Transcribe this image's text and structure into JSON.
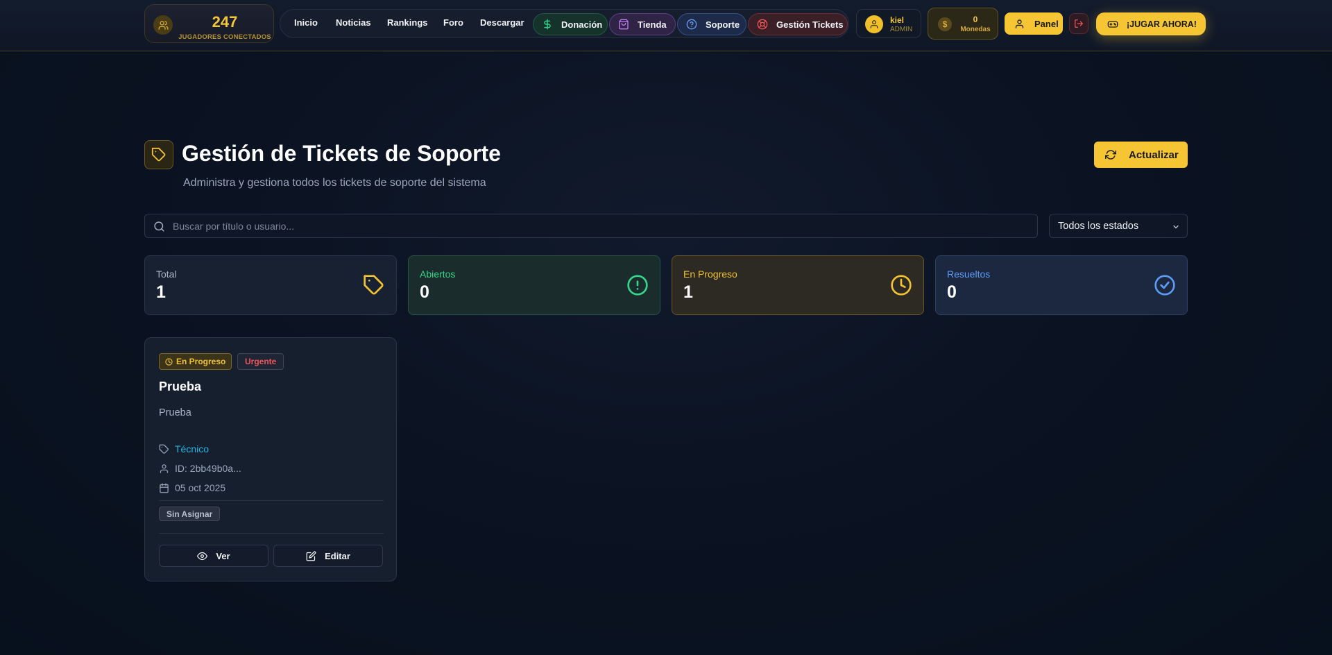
{
  "topbar": {
    "players": {
      "count": "247",
      "label": "JUGADORES CONECTADOS",
      "icon": "users-icon"
    },
    "nav": [
      {
        "label": "Inicio"
      },
      {
        "label": "Noticias"
      },
      {
        "label": "Rankings"
      },
      {
        "label": "Foro"
      },
      {
        "label": "Descargar"
      }
    ],
    "pills": {
      "donation": {
        "label": "Donación",
        "icon": "dollar-icon",
        "color": "#22c57e"
      },
      "store": {
        "label": "Tienda",
        "icon": "shopping-bag-icon",
        "color": "#b06ae0"
      },
      "support": {
        "label": "Soporte",
        "icon": "help-circle-icon",
        "color": "#5c8ff0"
      },
      "tickets": {
        "label": "Gestión Tickets",
        "icon": "life-buoy-icon",
        "color": "#f0555a"
      }
    },
    "user": {
      "name": "kiel",
      "role": "ADMIN",
      "icon": "user-icon"
    },
    "coins": {
      "value": "0",
      "label": "Monedas",
      "icon": "money-bag-icon"
    },
    "panel_label": "Panel",
    "logout_icon": "logout-icon",
    "play_label": "¡JUGAR AHORA!",
    "play_icon": "gamepad-icon"
  },
  "header": {
    "title": "Gestión de Tickets de Soporte",
    "subtitle": "Administra y gestiona todos los tickets de soporte del sistema",
    "icon": "tag-icon",
    "refresh_label": "Actualizar",
    "refresh_icon": "refresh-icon"
  },
  "filters": {
    "search_placeholder": "Buscar por título o usuario...",
    "search_value": "",
    "status_selected": "Todos los estados"
  },
  "stats": [
    {
      "label": "Total",
      "value": "1",
      "icon": "tag-icon",
      "color": "#f2c233"
    },
    {
      "label": "Abiertos",
      "value": "0",
      "icon": "alert-circle-icon",
      "color": "#35d58a"
    },
    {
      "label": "En Progreso",
      "value": "1",
      "icon": "clock-icon",
      "color": "#f2c233"
    },
    {
      "label": "Resueltos",
      "value": "0",
      "icon": "check-circle-icon",
      "color": "#5c9cf5"
    }
  ],
  "tickets": [
    {
      "status": "En Progreso",
      "priority": "Urgente",
      "title": "Prueba",
      "description": "Prueba",
      "category": "Técnico",
      "user_id": "ID: 2bb49b0a...",
      "date": "05 oct 2025",
      "assignee": "Sin Asignar",
      "view_label": "Ver",
      "edit_label": "Editar"
    }
  ],
  "colors": {
    "accent": "#f5c534",
    "background": "#0b1322"
  }
}
